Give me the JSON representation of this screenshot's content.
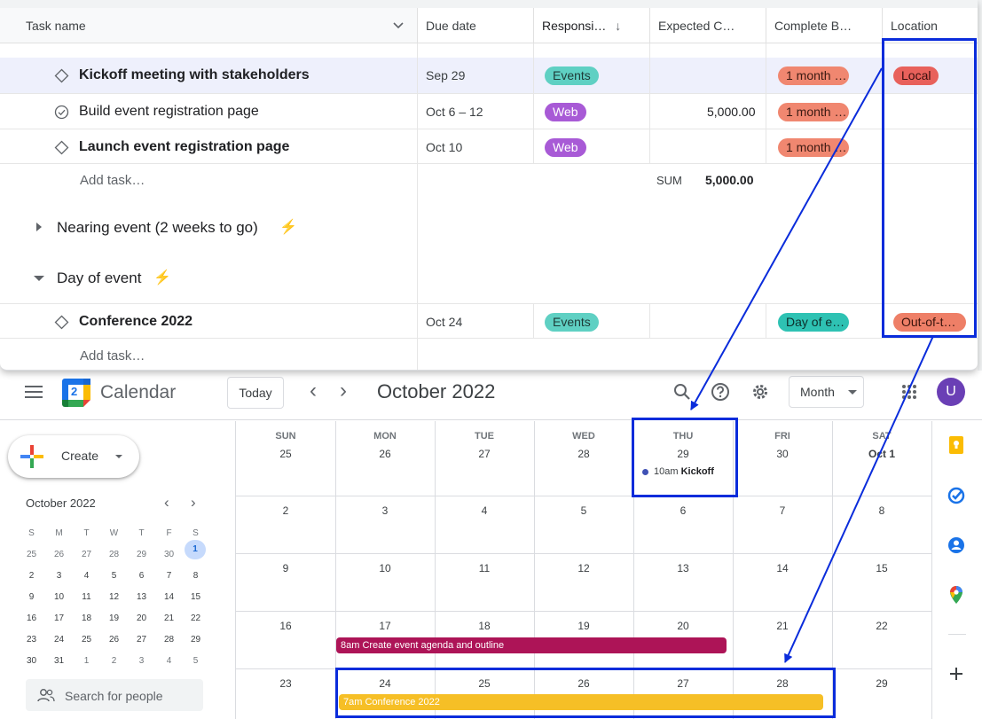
{
  "tasks_table": {
    "columns": [
      "Task name",
      "Due date",
      "Responsi…",
      "Expected C…",
      "Complete B…",
      "Location"
    ],
    "sort_arrow": "↓",
    "rows": [
      {
        "name": "Kickoff meeting with stakeholders",
        "date": "Sep 29",
        "responsible": "Events",
        "expected": "",
        "complete": "1 month …",
        "location": "Local"
      },
      {
        "name": "Build event registration page",
        "date": "Oct 6 – 12",
        "responsible": "Web",
        "expected": "5,000.00",
        "complete": "1 month …",
        "location": ""
      },
      {
        "name": "Launch event registration page",
        "date": "Oct 10",
        "responsible": "Web",
        "expected": "",
        "complete": "1 month …",
        "location": ""
      }
    ],
    "add_task": "Add task…",
    "sum_label": "SUM",
    "sum_value": "5,000.00",
    "sections": [
      {
        "title": "Nearing event (2 weeks to go)",
        "collapsed": true
      },
      {
        "title": "Day of event",
        "collapsed": false
      }
    ],
    "day_of_rows": [
      {
        "name": "Conference 2022",
        "date": "Oct 24",
        "responsible": "Events",
        "expected": "",
        "complete": "Day of e…",
        "location": "Out-of-t…"
      }
    ],
    "add_task_2": "Add task…"
  },
  "calendar": {
    "app_name": "Calendar",
    "logo_day": "2",
    "today_label": "Today",
    "prev_icon": "‹",
    "next_icon": "›",
    "month_title": "October 2022",
    "view_label": "Month",
    "avatar_letter": "U",
    "create_label": "Create",
    "mini_title": "October 2022",
    "mini_dow": [
      "S",
      "M",
      "T",
      "W",
      "T",
      "F",
      "S"
    ],
    "mini_weeks": [
      [
        "25",
        "26",
        "27",
        "28",
        "29",
        "30",
        "1"
      ],
      [
        "2",
        "3",
        "4",
        "5",
        "6",
        "7",
        "8"
      ],
      [
        "9",
        "10",
        "11",
        "12",
        "13",
        "14",
        "15"
      ],
      [
        "16",
        "17",
        "18",
        "19",
        "20",
        "21",
        "22"
      ],
      [
        "23",
        "24",
        "25",
        "26",
        "27",
        "28",
        "29"
      ],
      [
        "30",
        "31",
        "1",
        "2",
        "3",
        "4",
        "5"
      ]
    ],
    "search_people": "Search for people",
    "dow": [
      "SUN",
      "MON",
      "TUE",
      "WED",
      "THU",
      "FRI",
      "SAT"
    ],
    "weeks": [
      [
        "25",
        "26",
        "27",
        "28",
        "29",
        "30",
        "Oct 1"
      ],
      [
        "2",
        "3",
        "4",
        "5",
        "6",
        "7",
        "8"
      ],
      [
        "9",
        "10",
        "11",
        "12",
        "13",
        "14",
        "15"
      ],
      [
        "16",
        "17",
        "18",
        "19",
        "20",
        "21",
        "22"
      ],
      [
        "23",
        "24",
        "25",
        "26",
        "27",
        "28",
        "29"
      ]
    ],
    "events": {
      "kickoff_time": "10am",
      "kickoff_title": "Kickoff",
      "agenda": "8am Create event agenda and outline",
      "conference": "7am Conference 2022"
    },
    "colors": {
      "agenda": "#ad1457",
      "conference": "#f6bf26",
      "kickoff_dot": "#3f51b5",
      "highlight": "#0a2cdb"
    }
  }
}
